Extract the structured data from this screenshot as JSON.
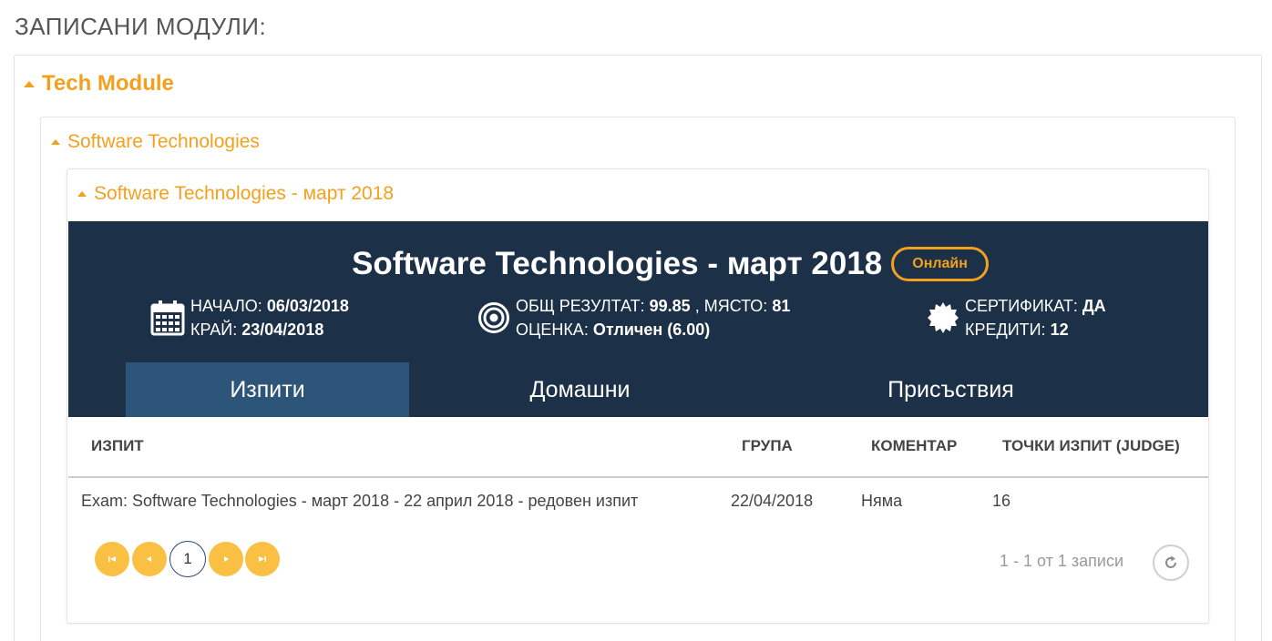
{
  "page": {
    "heading": "ЗАПИСАНИ МОДУЛИ:"
  },
  "module": {
    "title": "Tech Module"
  },
  "course": {
    "title": "Software Technologies"
  },
  "instance": {
    "title": "Software Technologies - март 2018",
    "heading": "Software Technologies - март 2018",
    "badge": "Онлайн"
  },
  "dates": {
    "start_label": "НАЧАЛО:",
    "start_value": "06/03/2018",
    "end_label": "КРАЙ:",
    "end_value": "23/04/2018"
  },
  "results": {
    "total_label": "ОБЩ РЕЗУЛТАТ:",
    "total_value": "99.85",
    "place_label": ", МЯСТО:",
    "place_value": "81",
    "grade_label": "ОЦЕНКА:",
    "grade_value": "Отличен (6.00)"
  },
  "certificate": {
    "cert_label": "СЕРТИФИКАТ:",
    "cert_value": "ДА",
    "credits_label": "КРЕДИТИ:",
    "credits_value": "12"
  },
  "tabs": [
    {
      "label": "Изпити",
      "active": true
    },
    {
      "label": "Домашни",
      "active": false
    },
    {
      "label": "Присъствия",
      "active": false
    }
  ],
  "table": {
    "headers": [
      "ИЗПИТ",
      "ГРУПА",
      "КОМЕНТАР",
      "ТОЧКИ ИЗПИТ (JUDGE)"
    ],
    "rows": [
      [
        "Exam: Software Technologies - март 2018 - 22 април 2018 - редовен изпит",
        "22/04/2018",
        "Няма",
        "16"
      ]
    ]
  },
  "pager": {
    "current_page": "1",
    "records_info": "1 - 1 от 1 записи"
  },
  "colors": {
    "accent": "#f4a01f",
    "panel": "#1c3047",
    "active_tab": "#2d5479",
    "pager": "#f9c044"
  },
  "icons": [
    "calendar-icon",
    "target-icon",
    "certificate-seal-icon",
    "first-page-icon",
    "prev-page-icon",
    "next-page-icon",
    "last-page-icon",
    "refresh-icon",
    "caret-up-icon"
  ]
}
